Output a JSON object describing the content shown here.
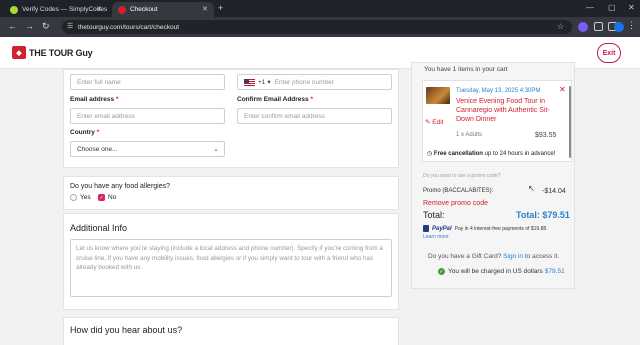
{
  "browser": {
    "tabs": [
      {
        "title": "Verify Codes — SimplyCodes",
        "favicon_color": "#a6d93a"
      },
      {
        "title": "Checkout",
        "favicon_color": "#d3202f"
      }
    ],
    "url": "thetourguy.com/tours/cart/checkout"
  },
  "site": {
    "logo_text": "THE TOUR Guy",
    "exit_label": "Exit"
  },
  "form": {
    "fullname_placeholder": "Enter full name",
    "phone_code": "+1",
    "phone_placeholder": "Enter phone number",
    "email_label": "Email address",
    "email_placeholder": "Enter email address",
    "confirm_email_label": "Confirm Email Address",
    "confirm_email_placeholder": "Enter confirm email address",
    "country_label": "Country",
    "country_value": "Choose one...",
    "required_mark": "*"
  },
  "allergies": {
    "question": "Do you have any food allergies?",
    "yes_label": "Yes",
    "no_label": "No",
    "selected": "No"
  },
  "additional_info": {
    "title": "Additional Info",
    "placeholder": "Let us know where you're staying (include a local address and phone number). Specify if you're coming from a cruise line, if you have any mobility issues, food allergies or if you simply want to tour with a friend who has already booked with us."
  },
  "hear_about": {
    "title": "How did you hear about us?"
  },
  "cart": {
    "header": "You have 1 items in your cart",
    "item": {
      "date": "Tuesday, May 13, 2025 4:30PM",
      "title": "Venice Evening Food Tour in Cannaregio with Authentic Sit-Down Dinner",
      "edit_label": "Edit",
      "guests": "1 x Adults",
      "price": "$93.55",
      "cancellation_bold": "Free cancellation",
      "cancellation_rest": " up to 24 hours in advance!"
    },
    "promo_hint": "Do you want to use a promo code?",
    "promo_label": "Promo (BACCALABITES):",
    "promo_amount": "-$14.04",
    "remove_promo": "Remove promo code",
    "total_label": "Total:",
    "total_value": "Total: $79.51",
    "paypal_brand": "PayPal",
    "paypal_text": "Pay in 4 interest-free payments of $19.88.",
    "learn_more": "Learn more",
    "gift_text": "Do you have a Gift Card?",
    "gift_signin": "Sign in",
    "gift_rest": " to access it.",
    "currency_text": "You will be charged in US dollars",
    "currency_amount": "$79.51"
  },
  "colors": {
    "brand_red": "#d3202f",
    "link_blue": "#2b7fc9",
    "exit_pink": "#c2185b"
  }
}
